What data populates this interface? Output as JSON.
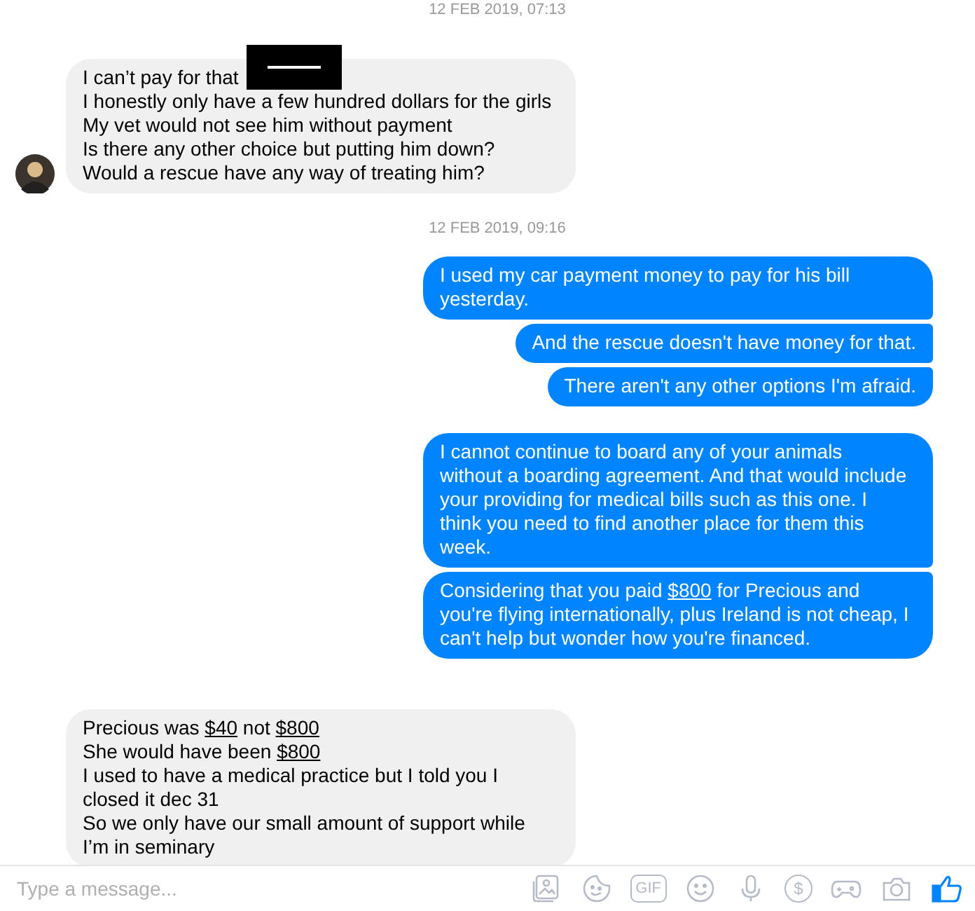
{
  "feed": [
    {
      "kind": "timestamp",
      "text": "12 FEB 2019, 07:13"
    },
    {
      "kind": "received",
      "avatar": true,
      "messages": [
        {
          "lines": [
            {
              "segments": [
                {
                  "text": "I can’t pay for that",
                  "link": false
                }
              ],
              "redacted": true
            },
            {
              "segments": [
                {
                  "text": "I honestly only have a few hundred dollars for the girls",
                  "link": false
                }
              ]
            },
            {
              "segments": [
                {
                  "text": "My vet would not see him without payment",
                  "link": false
                }
              ]
            },
            {
              "segments": [
                {
                  "text": "Is there any other choice but putting him down?",
                  "link": false
                }
              ]
            },
            {
              "segments": [
                {
                  "text": "Would a rescue have any way of treating him?",
                  "link": false
                }
              ]
            }
          ]
        }
      ]
    },
    {
      "kind": "timestamp",
      "text": "12 FEB 2019, 09:16"
    },
    {
      "kind": "sent",
      "messages": [
        {
          "lines": [
            {
              "segments": [
                {
                  "text": "I used my car payment money to pay for his bill",
                  "link": false
                }
              ]
            },
            {
              "segments": [
                {
                  "text": "yesterday.",
                  "link": false
                }
              ]
            }
          ]
        },
        {
          "lines": [
            {
              "segments": [
                {
                  "text": "And the rescue doesn't have money for that.",
                  "link": false
                }
              ]
            }
          ]
        },
        {
          "lines": [
            {
              "segments": [
                {
                  "text": "There aren't any other options I'm afraid.",
                  "link": false
                }
              ]
            }
          ]
        }
      ]
    },
    {
      "kind": "sent",
      "messages": [
        {
          "lines": [
            {
              "segments": [
                {
                  "text": "I cannot continue to board any of your animals",
                  "link": false
                }
              ]
            },
            {
              "segments": [
                {
                  "text": "without a boarding agreement. And that would include",
                  "link": false
                }
              ]
            },
            {
              "segments": [
                {
                  "text": "your providing for medical bills such as this one. I",
                  "link": false
                }
              ]
            },
            {
              "segments": [
                {
                  "text": "think you need to find another place for them this",
                  "link": false
                }
              ]
            },
            {
              "segments": [
                {
                  "text": "week.",
                  "link": false
                }
              ]
            }
          ]
        },
        {
          "lines": [
            {
              "segments": [
                {
                  "text": "Considering that you paid ",
                  "link": false
                },
                {
                  "text": "$800",
                  "link": true
                },
                {
                  "text": " for Precious and",
                  "link": false
                }
              ]
            },
            {
              "segments": [
                {
                  "text": "you're flying internationally, plus Ireland is not cheap, I",
                  "link": false
                }
              ]
            },
            {
              "segments": [
                {
                  "text": "can't help but wonder how you're financed.",
                  "link": false
                }
              ]
            }
          ]
        }
      ]
    },
    {
      "kind": "received",
      "avatar": false,
      "messages": [
        {
          "lines": [
            {
              "segments": [
                {
                  "text": "Precious was ",
                  "link": false
                },
                {
                  "text": "$40",
                  "link": true
                },
                {
                  "text": " not ",
                  "link": false
                },
                {
                  "text": "$800",
                  "link": true
                }
              ]
            },
            {
              "segments": [
                {
                  "text": "She would have been ",
                  "link": false
                },
                {
                  "text": "$800",
                  "link": true
                }
              ]
            },
            {
              "segments": [
                {
                  "text": "I used to have a medical practice but I told you I",
                  "link": false
                }
              ]
            },
            {
              "segments": [
                {
                  "text": "closed it dec 31",
                  "link": false
                }
              ]
            },
            {
              "segments": [
                {
                  "text": "So we only have our small amount of support while",
                  "link": false
                }
              ]
            },
            {
              "segments": [
                {
                  "text": "I’m in seminary",
                  "link": false
                }
              ]
            }
          ]
        }
      ]
    }
  ],
  "composer": {
    "placeholder": "Type a message...",
    "tools": [
      {
        "kind": "image"
      },
      {
        "kind": "sticker"
      },
      {
        "kind": "gif",
        "label": "GIF"
      },
      {
        "kind": "emoji"
      },
      {
        "kind": "mic"
      },
      {
        "kind": "payment",
        "label": "$"
      },
      {
        "kind": "game"
      },
      {
        "kind": "camera"
      },
      {
        "kind": "like"
      }
    ]
  }
}
